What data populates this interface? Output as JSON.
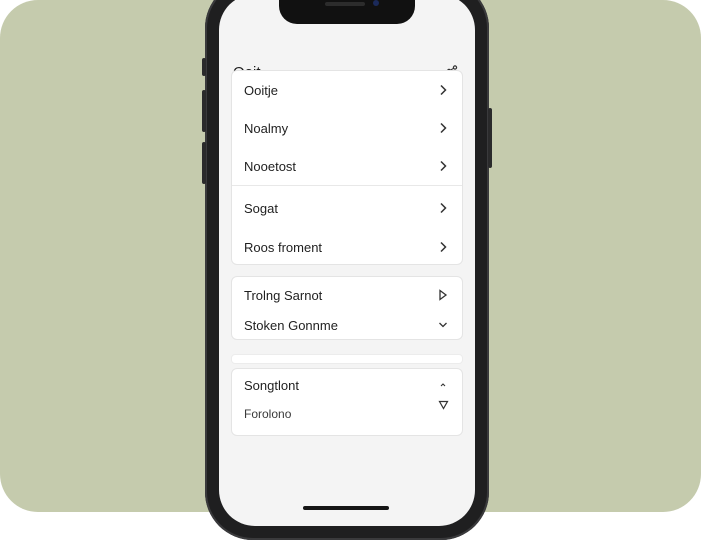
{
  "header": {
    "title": "Ooit",
    "action_icon": "share-icon"
  },
  "groups": [
    {
      "items": [
        {
          "label": "Ooitje",
          "icon": "chevron-right-icon"
        },
        {
          "label": "Noalmy",
          "icon": "chevron-right-icon"
        },
        {
          "label": "Nooetost",
          "icon": "chevron-right-icon"
        }
      ]
    },
    {
      "items": [
        {
          "label": "Sogat",
          "icon": "chevron-right-icon"
        },
        {
          "label": "Roos froment",
          "icon": "chevron-right-icon"
        }
      ]
    },
    {
      "items": [
        {
          "label": "Trolng Sarnot",
          "icon": "play-outline-icon"
        },
        {
          "label": "Stoken Gonnme",
          "icon": "chevron-down-icon"
        }
      ]
    },
    {
      "items": [
        {
          "label": "Songtlont",
          "icon": "caret-up-icon"
        },
        {
          "label": "Forolono",
          "icon": "triangle-down-outline-icon"
        }
      ]
    }
  ],
  "colors": {
    "backdrop": "#c5cbad",
    "phone_frame": "#1f1f20",
    "screen": "#f4f4f4",
    "card": "#ffffff"
  }
}
